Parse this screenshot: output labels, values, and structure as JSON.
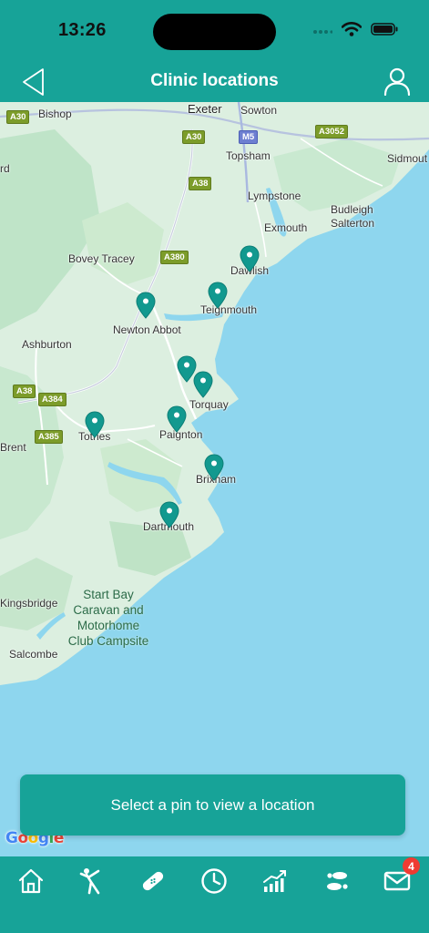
{
  "status": {
    "time": "13:26"
  },
  "header": {
    "title": "Clinic locations"
  },
  "map": {
    "places": [
      {
        "id": "bishop",
        "label": "Bishop"
      },
      {
        "id": "exeter",
        "label": "Exeter"
      },
      {
        "id": "sowton",
        "label": "Sowton"
      },
      {
        "id": "topsham",
        "label": "Topsham"
      },
      {
        "id": "sidmouth",
        "label": "Sidmout"
      },
      {
        "id": "rd",
        "label": "rd"
      },
      {
        "id": "lympstone",
        "label": "Lympstone"
      },
      {
        "id": "budleigh",
        "label": "Budleigh"
      },
      {
        "id": "salterton",
        "label": "Salterton"
      },
      {
        "id": "exmouth",
        "label": "Exmouth"
      },
      {
        "id": "bovey",
        "label": "Bovey Tracey"
      },
      {
        "id": "dawlish",
        "label": "Dawlish"
      },
      {
        "id": "teignmouth",
        "label": "Teignmouth"
      },
      {
        "id": "newton",
        "label": "Newton Abbot"
      },
      {
        "id": "ashburton",
        "label": "Ashburton"
      },
      {
        "id": "torquay",
        "label": "Torquay"
      },
      {
        "id": "paignton",
        "label": "Paignton"
      },
      {
        "id": "totnes",
        "label": "Totnes"
      },
      {
        "id": "brent",
        "label": "Brent"
      },
      {
        "id": "brixham",
        "label": "Brixham"
      },
      {
        "id": "dartmouth",
        "label": "Dartmouth"
      },
      {
        "id": "kingsbridge",
        "label": "Kingsbridge"
      },
      {
        "id": "salcombe",
        "label": "Salcombe"
      }
    ],
    "poi": {
      "line1": "Start Bay",
      "line2": "Caravan and",
      "line3": "Motorhome",
      "line4": "Club Campsite"
    },
    "roads": [
      {
        "id": "a30a",
        "label": "A30"
      },
      {
        "id": "a30b",
        "label": "A30"
      },
      {
        "id": "m5",
        "label": "M5"
      },
      {
        "id": "a3052",
        "label": "A3052"
      },
      {
        "id": "a38a",
        "label": "A38"
      },
      {
        "id": "a380",
        "label": "A380"
      },
      {
        "id": "a38b",
        "label": "A38"
      },
      {
        "id": "a384",
        "label": "A384"
      },
      {
        "id": "a385",
        "label": "A385"
      }
    ],
    "attribution": "Google",
    "pin_color": "#12998f"
  },
  "card": {
    "text": "Select a pin to view a location"
  },
  "tabs": [
    {
      "id": "home",
      "icon": "home-icon"
    },
    {
      "id": "exercise",
      "icon": "exercise-icon"
    },
    {
      "id": "treatment",
      "icon": "bandage-icon"
    },
    {
      "id": "history",
      "icon": "clock-icon"
    },
    {
      "id": "progress",
      "icon": "chart-icon"
    },
    {
      "id": "steps",
      "icon": "footprints-icon"
    },
    {
      "id": "messages",
      "icon": "mail-icon",
      "badge": "4"
    }
  ],
  "colors": {
    "brand": "#17a398",
    "sea": "#8ed6ee",
    "land": "#dcefe0",
    "badge": "#ef3b32"
  }
}
